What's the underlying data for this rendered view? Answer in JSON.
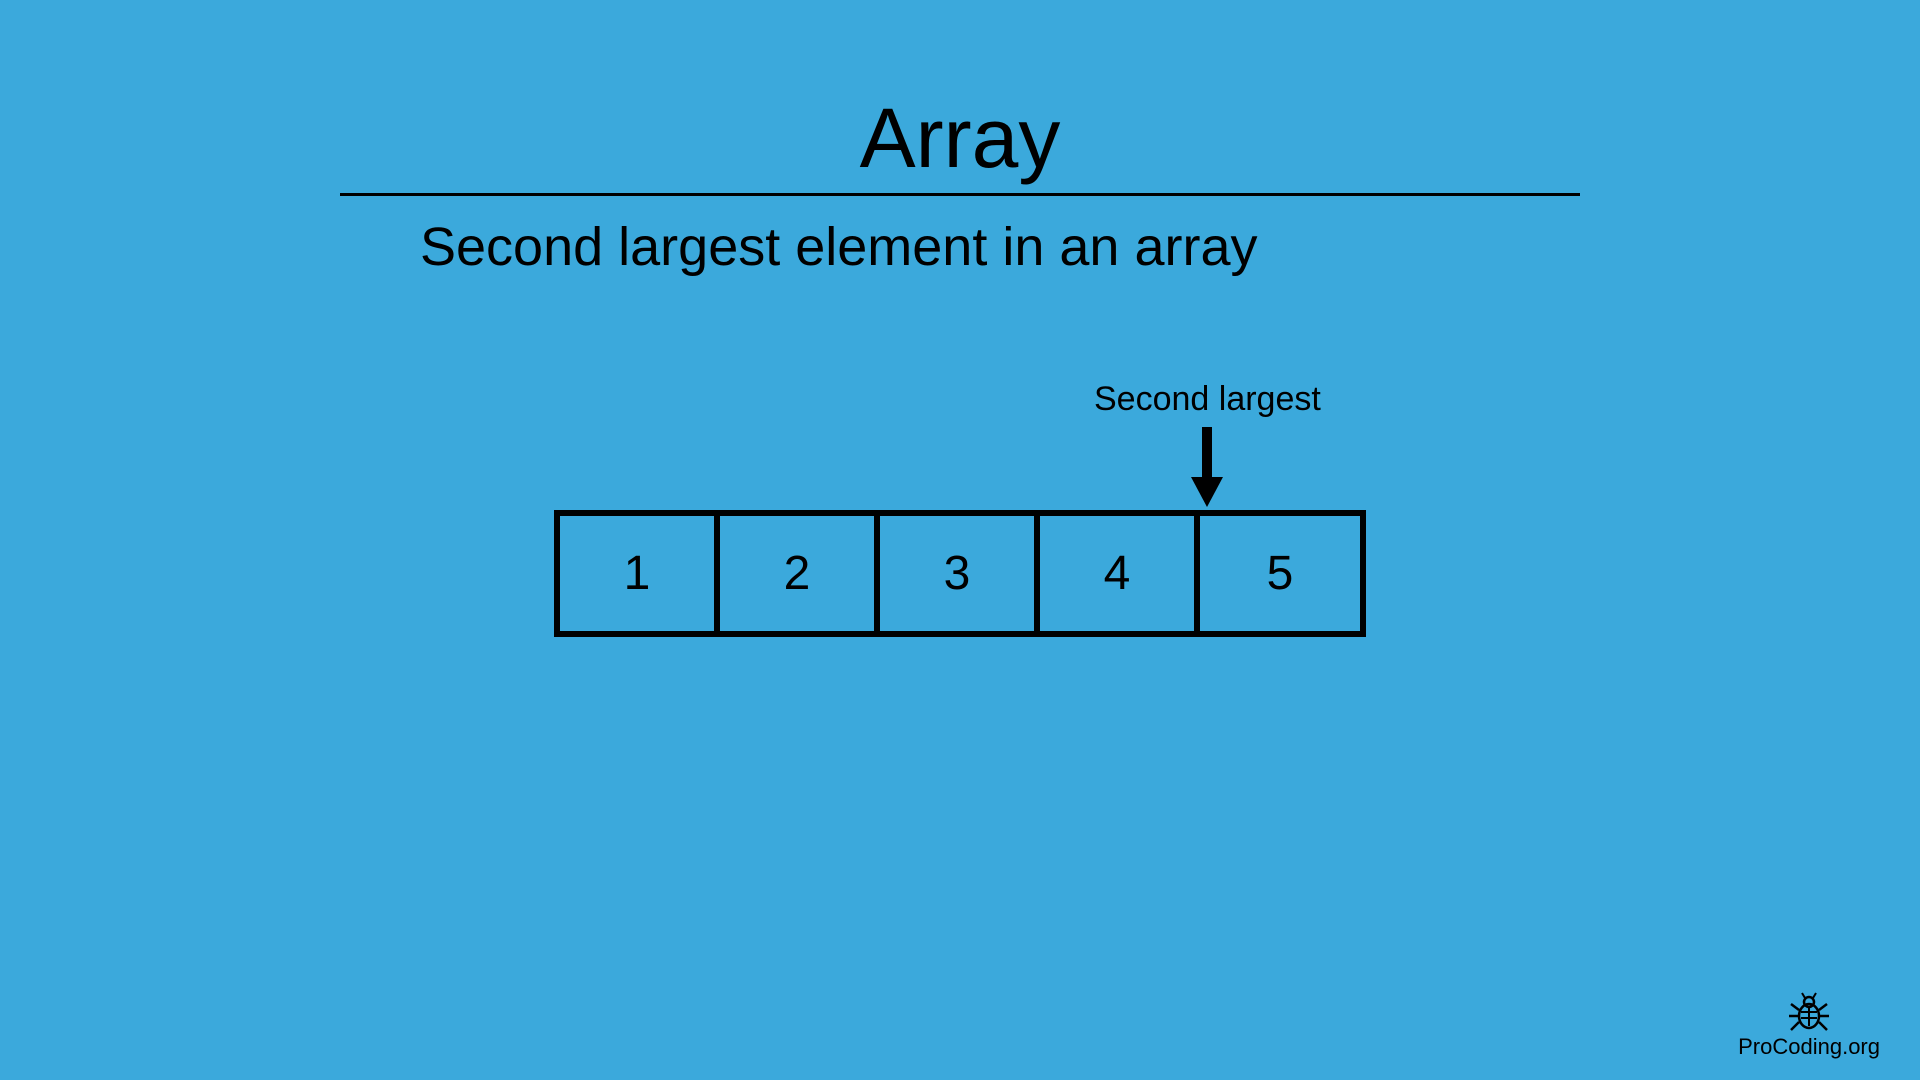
{
  "title": "Array",
  "subtitle": "Second largest element in an array",
  "annotation": {
    "label": "Second largest",
    "target_index": 3
  },
  "array": [
    "1",
    "2",
    "3",
    "4",
    "5"
  ],
  "footer": {
    "brand": "ProCoding.org"
  },
  "colors": {
    "background": "#3ba9dc",
    "foreground": "#000000"
  }
}
